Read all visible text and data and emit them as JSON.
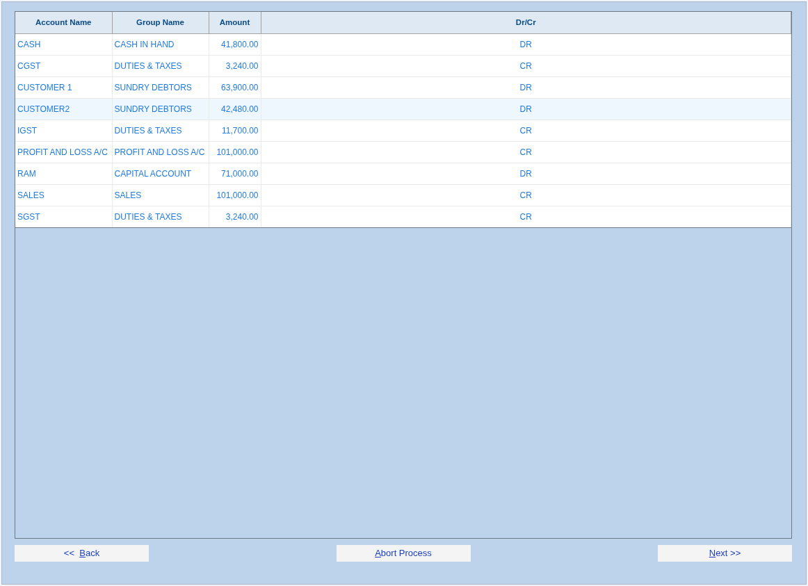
{
  "table": {
    "columns": [
      "Account Name",
      "Group Name",
      "Amount",
      "Dr/Cr"
    ],
    "rows": [
      {
        "cells": [
          "CASH",
          "CASH IN HAND",
          "41,800.00",
          "DR"
        ],
        "selected": false
      },
      {
        "cells": [
          "CGST",
          "DUTIES & TAXES",
          "3,240.00",
          "CR"
        ],
        "selected": false
      },
      {
        "cells": [
          "CUSTOMER 1",
          "SUNDRY DEBTORS",
          "63,900.00",
          "DR"
        ],
        "selected": false
      },
      {
        "cells": [
          "CUSTOMER2",
          "SUNDRY DEBTORS",
          "42,480.00",
          "DR"
        ],
        "selected": true
      },
      {
        "cells": [
          "IGST",
          "DUTIES & TAXES",
          "11,700.00",
          "CR"
        ],
        "selected": false
      },
      {
        "cells": [
          "PROFIT AND LOSS A/C",
          "PROFIT AND LOSS A/C",
          "101,000.00",
          "CR"
        ],
        "selected": false
      },
      {
        "cells": [
          "RAM",
          "CAPITAL ACCOUNT",
          "71,000.00",
          "DR"
        ],
        "selected": false
      },
      {
        "cells": [
          "SALES",
          "SALES",
          "101,000.00",
          "CR"
        ],
        "selected": false
      },
      {
        "cells": [
          "SGST",
          "DUTIES & TAXES",
          "3,240.00",
          "CR"
        ],
        "selected": false
      }
    ]
  },
  "buttons": [
    {
      "kind": "back",
      "before": "<<  ",
      "key": "B",
      "after": "ack"
    },
    {
      "kind": "abort",
      "key": "A",
      "after": "bort Process"
    },
    {
      "kind": "next",
      "key": "N",
      "after": "ext >>"
    }
  ]
}
